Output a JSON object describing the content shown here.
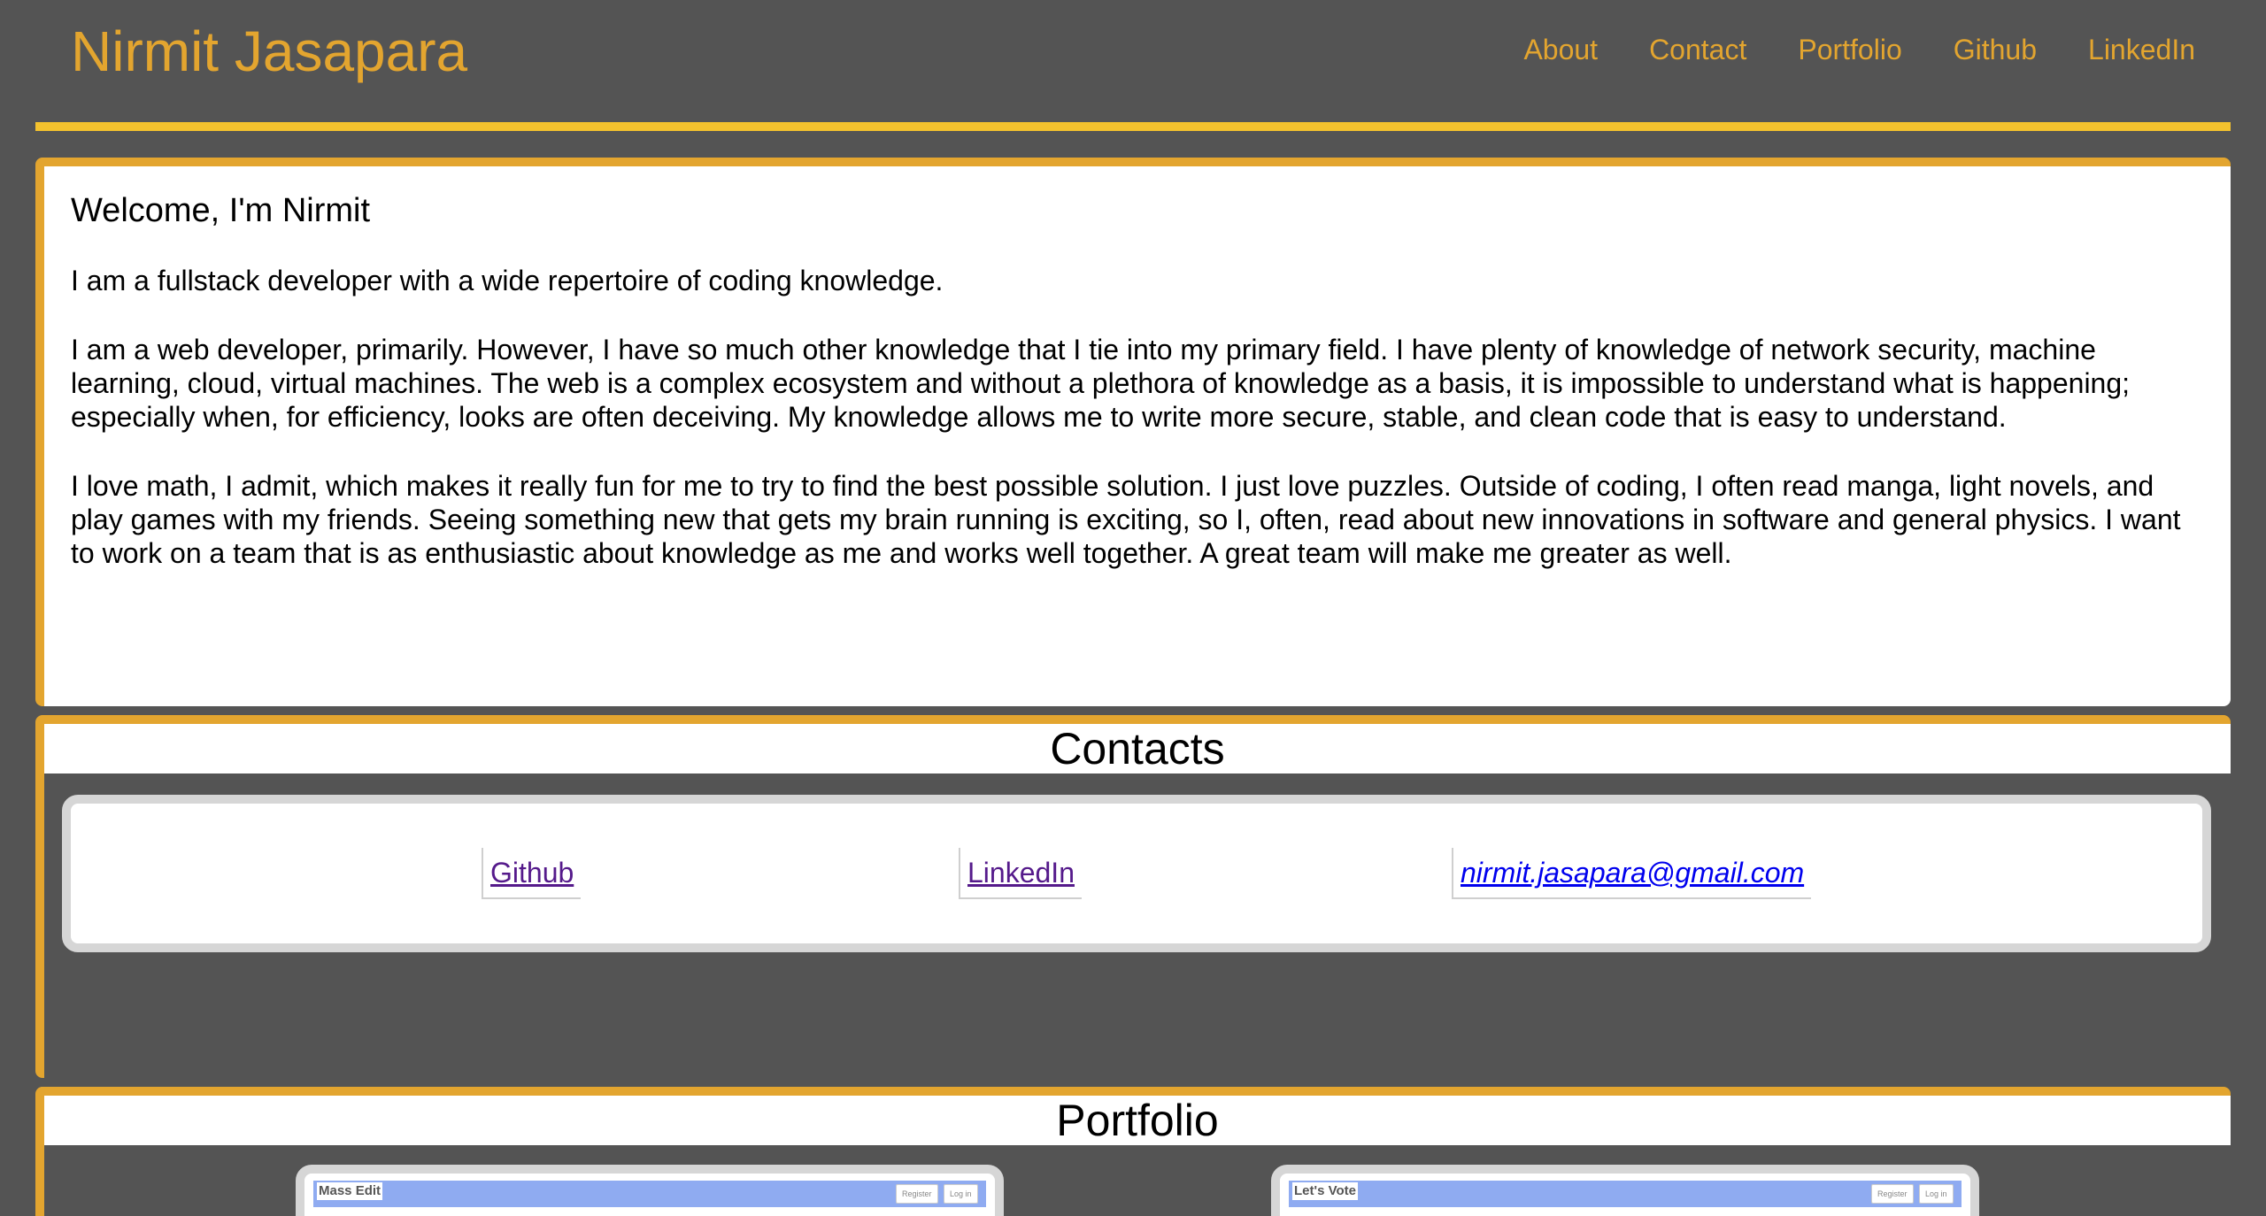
{
  "header": {
    "brand": "Nirmit Jasapara",
    "nav": [
      "About",
      "Contact",
      "Portfolio",
      "Github",
      "LinkedIn"
    ]
  },
  "about": {
    "heading": "Welcome, I'm Nirmit",
    "paragraphs": [
      "I am a fullstack developer with a wide repertoire of coding knowledge.",
      "I am a web developer, primarily. However, I have so much other knowledge that I tie into my primary field. I have plenty of knowledge of network security, machine learning, cloud, virtual machines. The web is a complex ecosystem and without a plethora of knowledge as a basis, it is impossible to understand what is happening; especially when, for efficiency, looks are often deceiving. My knowledge allows me to write more secure, stable, and clean code that is easy to understand.",
      "I love math, I admit, which makes it really fun for me to try to find the best possible solution. I just love puzzles. Outside of coding, I often read manga, light novels, and play games with my friends. Seeing something new that gets my brain running is exciting, so I, often, read about new innovations in software and general physics. I want to work on a team that is as enthusiastic about knowledge as me and works well together. A great team will make me greater as well."
    ]
  },
  "contacts": {
    "title": "Contacts",
    "github": "Github",
    "linkedin": "LinkedIn",
    "email": "nirmit.jasapara@gmail.com"
  },
  "portfolio": {
    "title": "Portfolio",
    "items": [
      {
        "title": "Mass Edit",
        "register": "Register",
        "login": "Log in"
      },
      {
        "title": "Let's Vote",
        "register": "Register",
        "login": "Log in"
      }
    ]
  },
  "colors": {
    "background": "#545454",
    "accent": "#e3a52f",
    "rule": "#f4c22e",
    "card_border": "#d6d6d6"
  }
}
